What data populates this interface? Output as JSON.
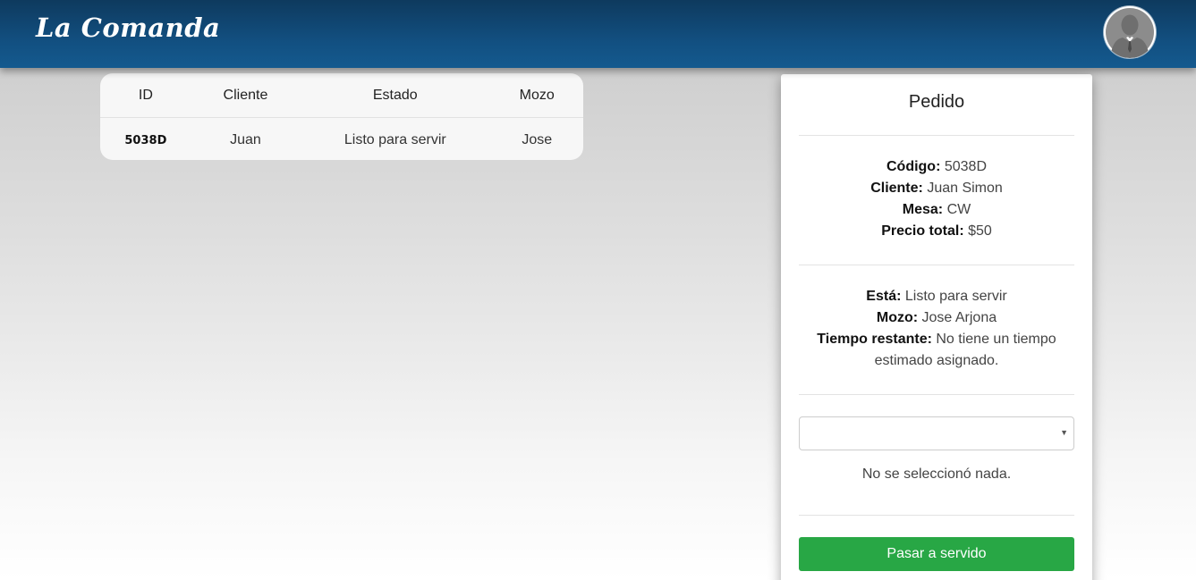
{
  "app": {
    "brand": "La Comanda"
  },
  "header": {
    "avatar_icon": "user-avatar-icon"
  },
  "orders_table": {
    "columns": [
      "ID",
      "Cliente",
      "Estado",
      "Mozo"
    ],
    "rows": [
      {
        "id": "5038D",
        "cliente": "Juan",
        "estado": "Listo para servir",
        "mozo": "Jose"
      }
    ]
  },
  "detail": {
    "title": "Pedido",
    "codigo_label": "Código:",
    "codigo_value": "5038D",
    "cliente_label": "Cliente:",
    "cliente_value": "Juan Simon",
    "mesa_label": "Mesa:",
    "mesa_value": "CW",
    "precio_label": "Precio total:",
    "precio_value": "$50",
    "esta_label": "Está:",
    "esta_value": "Listo para servir",
    "mozo_label": "Mozo:",
    "mozo_value": "Jose Arjona",
    "tiempo_label": "Tiempo restante:",
    "tiempo_value": "No tiene un tiempo estimado asignado.",
    "select_value": "",
    "select_status": "No se seleccionó nada.",
    "serve_button": "Pasar a servido"
  },
  "colors": {
    "header": "#124f80",
    "primary_button": "#28a745"
  }
}
